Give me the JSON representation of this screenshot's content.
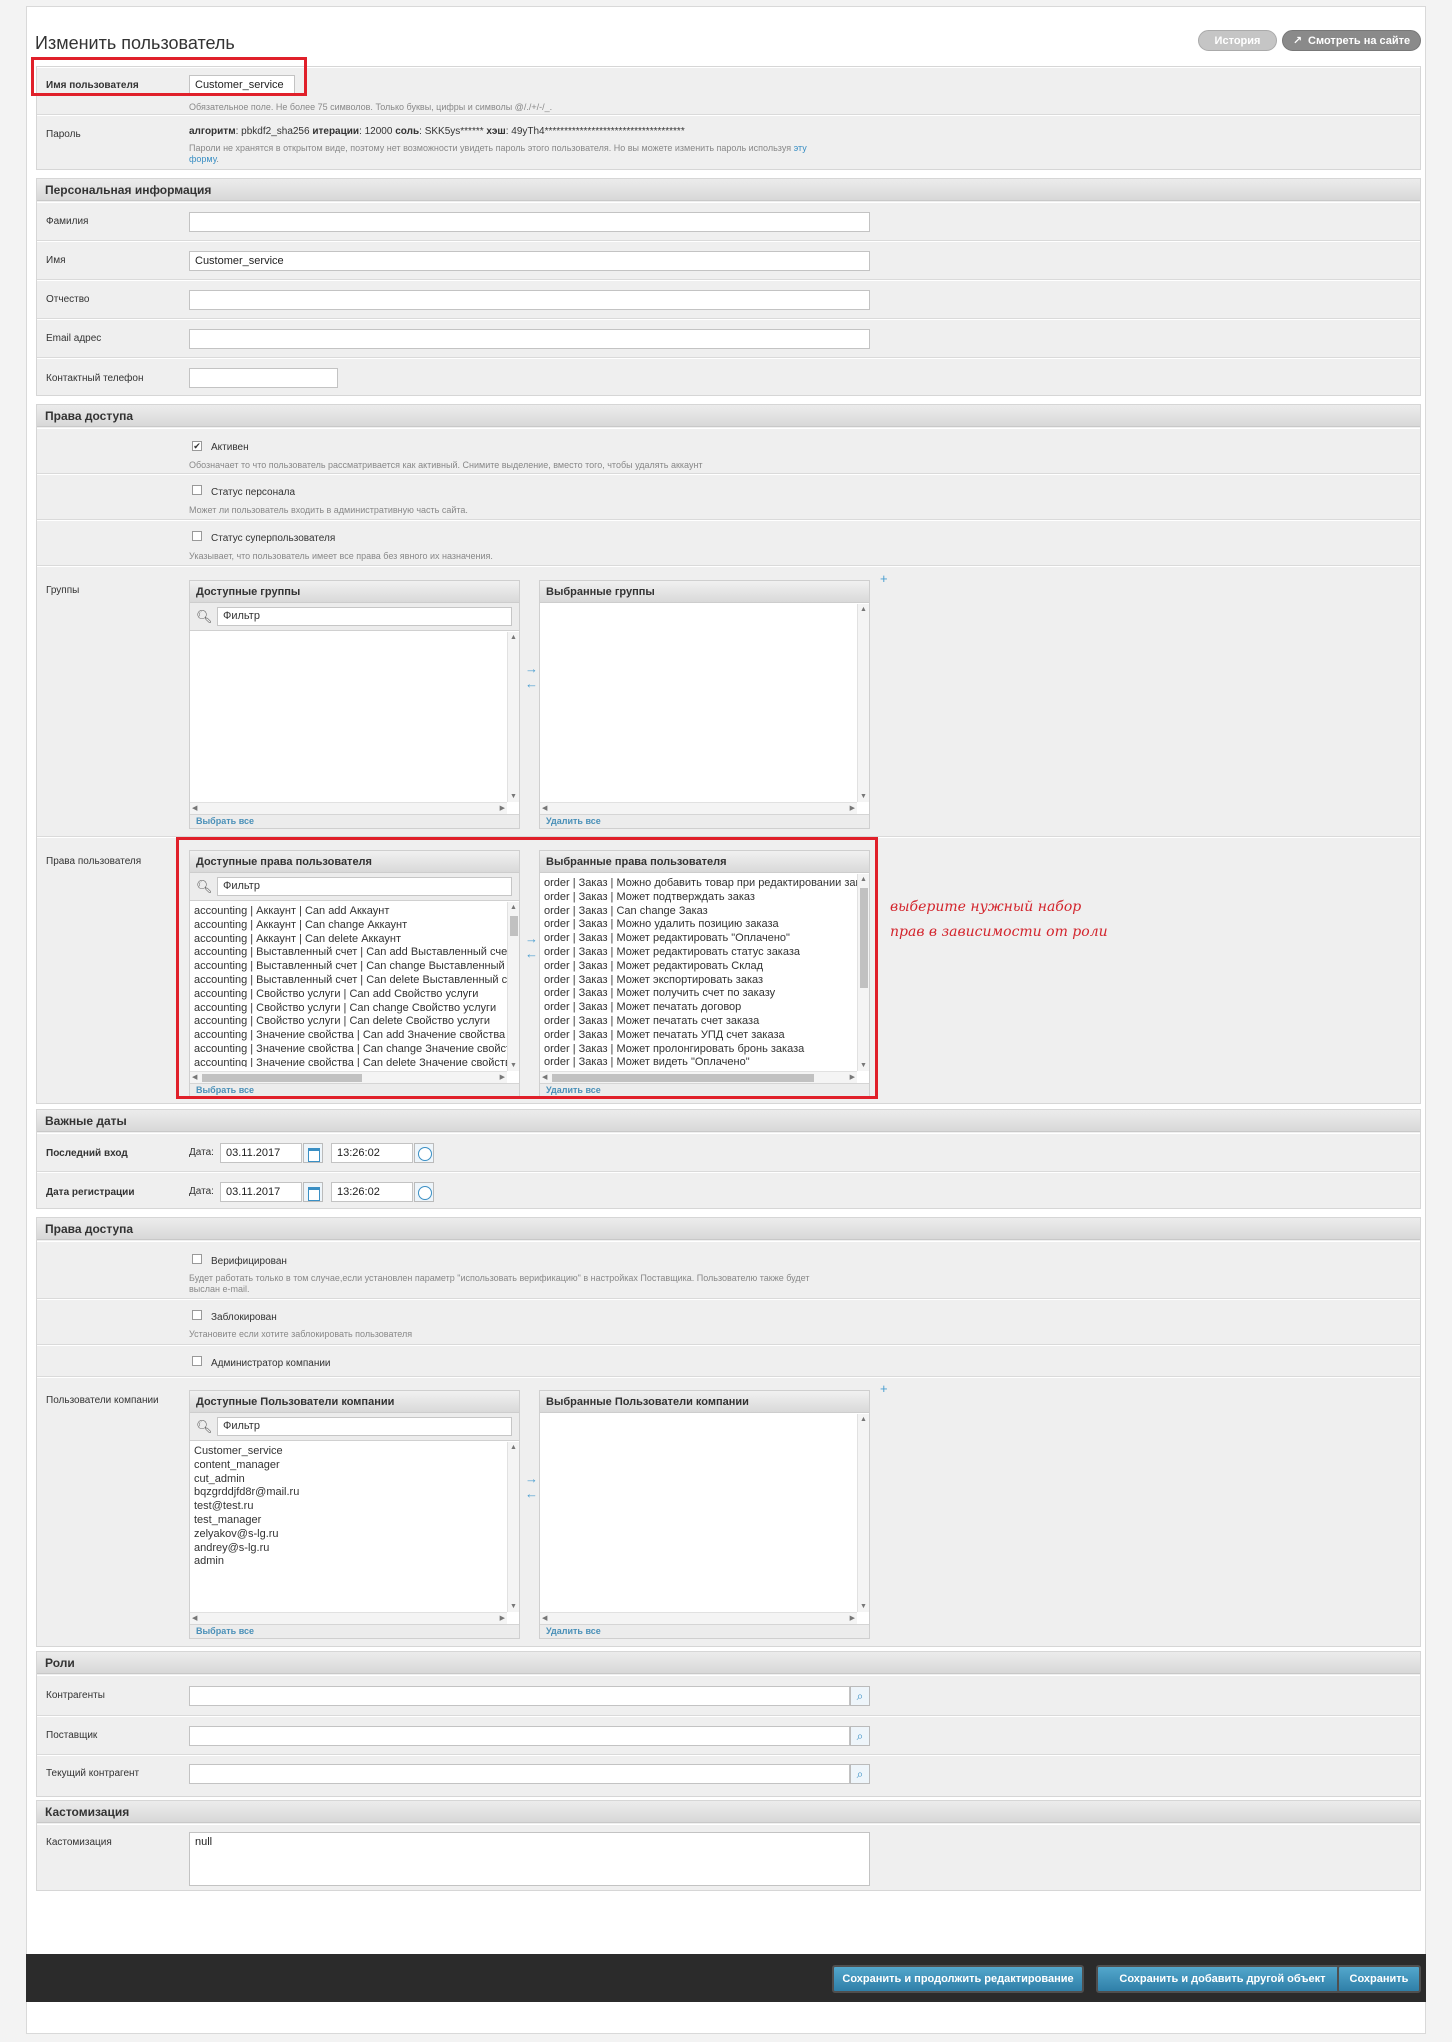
{
  "header": {
    "title": "Изменить пользователь",
    "history_label": "История",
    "view_on_site_label": "Смотреть на сайте"
  },
  "account": {
    "username_label": "Имя пользователя",
    "username_value": "Customer_service",
    "username_help": "Обязательное поле. Не более 75 символов. Только буквы, цифры и символы @/./+/-/_.",
    "password_label": "Пароль",
    "password_algo_key": "алгоритм",
    "password_algo_val": ": pbkdf2_sha256 ",
    "password_iter_key": "итерации",
    "password_iter_val": ": 12000 ",
    "password_salt_key": "соль",
    "password_salt_val": ": SKK5ys****** ",
    "password_hash_key": "хэш",
    "password_hash_val": ": 49yTh4************************************",
    "password_help_line1": "Пароли не хранятся в открытом виде, поэтому нет возможности увидеть пароль этого пользователя. Но вы можете изменить пароль используя",
    "password_help_link_a": "эту",
    "password_help_link_b": "форму",
    "password_help_end": "."
  },
  "personal": {
    "title": "Персональная информация",
    "last_name_label": "Фамилия",
    "last_name_value": "",
    "first_name_label": "Имя",
    "first_name_value": "Customer_service",
    "middle_name_label": "Отчество",
    "middle_name_value": "",
    "email_label": "Email адрес",
    "email_value": "",
    "phone_label": "Контактный телефон",
    "phone_value": ""
  },
  "permissions": {
    "title": "Права доступа",
    "active_label": "Активен",
    "active_checked": true,
    "active_help": "Обозначает то что пользователь рассматривается как активный. Снимите выделение, вместо того, чтобы удалять аккаунт",
    "staff_label": "Статус персонала",
    "staff_help": "Может ли пользователь входить в административную часть сайта.",
    "superuser_label": "Статус суперпользователя",
    "superuser_help": "Указывает, что пользователь имеет все права без явного их назначения.",
    "groups_label": "Группы",
    "groups_available_title": "Доступные группы",
    "groups_chosen_title": "Выбранные группы",
    "filter_placeholder": "Фильтр",
    "choose_all": "Выбрать все",
    "remove_all": "Удалить все",
    "user_perms_label": "Права пользователя",
    "user_perms_available_title": "Доступные права пользователя",
    "user_perms_chosen_title": "Выбранные права пользователя",
    "available_perms": [
      "accounting | Аккаунт | Can add Аккаунт",
      "accounting | Аккаунт | Can change Аккаунт",
      "accounting | Аккаунт | Can delete Аккаунт",
      "accounting | Выставленный счет | Can add Выставленный счет",
      "accounting | Выставленный счет | Can change Выставленный счет",
      "accounting | Выставленный счет | Can delete Выставленный счет",
      "accounting | Свойство услуги | Can add Свойство услуги",
      "accounting | Свойство услуги | Can change Свойство услуги",
      "accounting | Свойство услуги | Can delete Свойство услуги",
      "accounting | Значение свойства | Can add Значение свойства",
      "accounting | Значение свойства | Can change Значение свойства",
      "accounting | Значение свойства | Can delete Значение свойства"
    ],
    "chosen_perms": [
      "order | Заказ | Можно добавить товар при редактировании заказа",
      "order | Заказ | Может подтверждать заказ",
      "order | Заказ | Can change Заказ",
      "order | Заказ | Можно удалить позицию заказа",
      "order | Заказ | Может редактировать \"Оплачено\"",
      "order | Заказ | Может редактировать статус заказа",
      "order | Заказ | Может редактировать Склад",
      "order | Заказ | Может экспортировать заказ",
      "order | Заказ | Может получить счет по заказу",
      "order | Заказ | Может печатать договор",
      "order | Заказ | Может печатать счет заказа",
      "order | Заказ | Может печатать УПД счет заказа",
      "order | Заказ | Может пролонгировать бронь заказа",
      "order | Заказ | Может видеть \"Оплачено\""
    ],
    "annotation": "выберите нужный набор прав в зависимости от роли"
  },
  "dates": {
    "title": "Важные даты",
    "last_login_label": "Последний вход",
    "date_label": "Дата:",
    "last_login_date": "03.11.2017",
    "last_login_time": "13:26:02",
    "joined_label": "Дата регистрации",
    "joined_date": "03.11.2017",
    "joined_time": "13:26:02"
  },
  "access2": {
    "title": "Права доступа",
    "verified_label": "Верифицирован",
    "verified_help_1": "Будет работать только в том случае,если установлен параметр \"использовать верификацию\" в настройках Поставщика. Пользователю также будет",
    "verified_help_2": "выслан e-mail.",
    "blocked_label": "Заблокирован",
    "blocked_help": "Установите если хотите заблокировать пользователя",
    "company_admin_label": "Администратор компании",
    "company_users_label": "Пользователи компании",
    "company_users_available_title": "Доступные Пользователи компании",
    "company_users_chosen_title": "Выбранные Пользователи компании",
    "company_users": [
      "Customer_service",
      "content_manager",
      "cut_admin",
      "bqzgrddjfd8r@mail.ru",
      "test@test.ru",
      "test_manager",
      "zelyakov@s-lg.ru",
      "andrey@s-lg.ru",
      "admin"
    ]
  },
  "roles": {
    "title": "Роли",
    "contractors_label": "Контрагенты",
    "supplier_label": "Поставщик",
    "current_contractor_label": "Текущий контрагент"
  },
  "custom": {
    "title": "Кастомизация",
    "label": "Кастомизация",
    "value": "null"
  },
  "footer": {
    "save_continue": "Сохранить и продолжить редактирование",
    "save_add": "Сохранить и добавить другой объект",
    "save": "Сохранить"
  },
  "colors": {
    "accent": "#3a8fc4",
    "highlight": "#e0202a"
  }
}
